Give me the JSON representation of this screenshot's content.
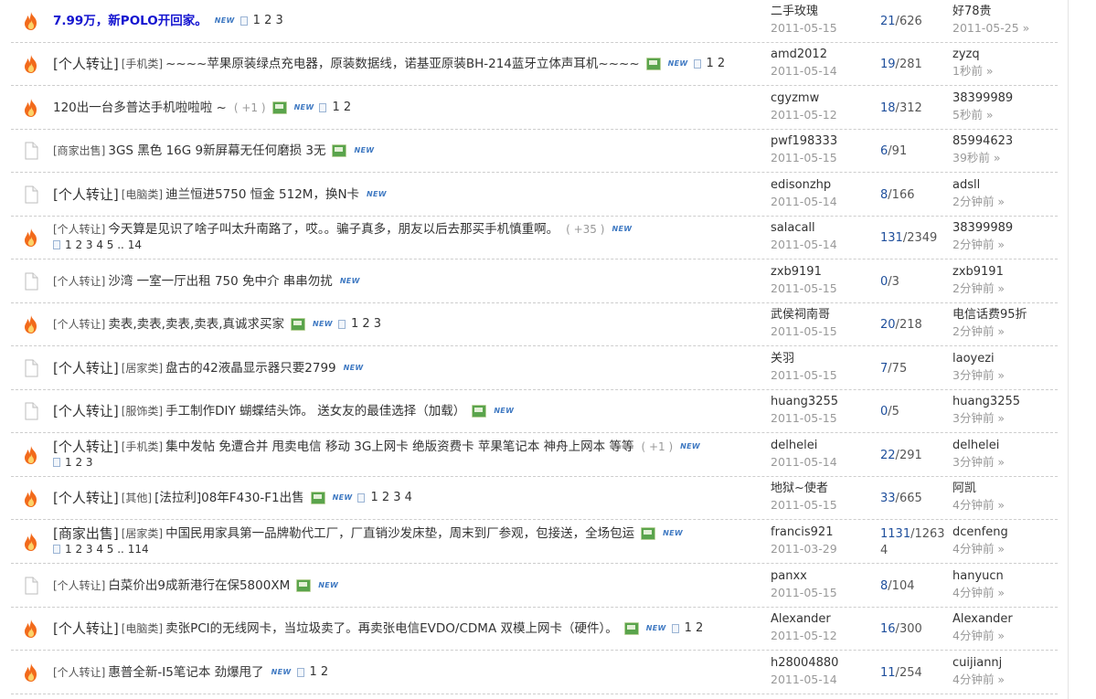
{
  "threads": [
    {
      "icon": "hot",
      "tag": "",
      "cat": "",
      "title": "7.99万，新POLO开回家。",
      "highlight": true,
      "recc": "",
      "img": false,
      "pages": "1 2 3",
      "pages_sub": "",
      "author": "二手玫瑰",
      "date": "2011-05-15",
      "replies": "21",
      "views": "626",
      "last_name": "好78贵",
      "last_time": "2011-05-25 »"
    },
    {
      "icon": "hot",
      "tag": "[个人转让]",
      "cat": "[手机类]",
      "title": "~~~~苹果原装绿点充电器，原装数据线，诺基亚原装BH-214蓝牙立体声耳机~~~~",
      "highlight": false,
      "recc": "",
      "img": true,
      "pages": "1 2",
      "pages_sub": "",
      "author": "amd2012",
      "date": "2011-05-14",
      "replies": "19",
      "views": "281",
      "last_name": "zyzq",
      "last_time": "1秒前 »"
    },
    {
      "icon": "hot",
      "tag": "",
      "cat": "",
      "title": "120出一台多普达手机啦啦啦 ~",
      "highlight": false,
      "recc": "( +1 )",
      "img": true,
      "pages": "1 2",
      "pages_sub": "",
      "author": "cgyzmw",
      "date": "2011-05-12",
      "replies": "18",
      "views": "312",
      "last_name": "38399989",
      "last_time": "5秒前 »"
    },
    {
      "icon": "file",
      "tag": "",
      "cat": "[商家出售]",
      "title": "3GS 黑色 16G 9新屏幕无任何磨损 3无",
      "highlight": false,
      "recc": "",
      "img": true,
      "pages": "",
      "pages_sub": "",
      "author": "pwf198333",
      "date": "2011-05-15",
      "replies": "6",
      "views": "91",
      "last_name": "85994623",
      "last_time": "39秒前 »"
    },
    {
      "icon": "file",
      "tag": "[个人转让]",
      "cat": "[电脑类]",
      "title": "迪兰恒进5750 恒金 512M，换N卡",
      "highlight": false,
      "recc": "",
      "img": false,
      "pages": "",
      "pages_sub": "",
      "author": "edisonzhp",
      "date": "2011-05-14",
      "replies": "8",
      "views": "166",
      "last_name": "adsll",
      "last_time": "2分钟前 »"
    },
    {
      "icon": "hot",
      "tag": "",
      "cat": "[个人转让]",
      "title": "今天算是见识了啥子叫太升南路了，哎。。骗子真多，朋友以后去那买手机慎重啊。",
      "highlight": false,
      "recc": "( +35 )",
      "img": false,
      "pages": "",
      "pages_sub": "1 2 3 4 5 .. 14",
      "author": "salacall",
      "date": "2011-05-14",
      "replies": "131",
      "views": "2349",
      "last_name": "38399989",
      "last_time": "2分钟前 »"
    },
    {
      "icon": "file",
      "tag": "",
      "cat": "[个人转让]",
      "title": "沙湾 一室一厅出租 750  免中介 串串勿扰",
      "highlight": false,
      "recc": "",
      "img": false,
      "pages": "",
      "pages_sub": "",
      "author": "zxb9191",
      "date": "2011-05-15",
      "replies": "0",
      "views": "3",
      "last_name": "zxb9191",
      "last_time": "2分钟前 »"
    },
    {
      "icon": "hot",
      "tag": "",
      "cat": "[个人转让]",
      "title": "卖表,卖表,卖表,卖表,真诚求买家",
      "highlight": false,
      "recc": "",
      "img": true,
      "pages": "1 2 3",
      "pages_sub": "",
      "author": "武侯祠南哥",
      "date": "2011-05-15",
      "replies": "20",
      "views": "218",
      "last_name": "电信话费95折",
      "last_time": "2分钟前 »"
    },
    {
      "icon": "file",
      "tag": "[个人转让]",
      "cat": "[居家类]",
      "title": "盘古的42液晶显示器只要2799",
      "highlight": false,
      "recc": "",
      "img": false,
      "pages": "",
      "pages_sub": "",
      "author": "关羽",
      "date": "2011-05-15",
      "replies": "7",
      "views": "75",
      "last_name": "laoyezi",
      "last_time": "3分钟前 »"
    },
    {
      "icon": "file",
      "tag": "[个人转让]",
      "cat": "[服饰类]",
      "title": "手工制作DIY 蝴蝶结头饰。 送女友的最佳选择（加载）",
      "highlight": false,
      "recc": "",
      "img": true,
      "pages": "",
      "pages_sub": "",
      "author": "huang3255",
      "date": "2011-05-15",
      "replies": "0",
      "views": "5",
      "last_name": "huang3255",
      "last_time": "3分钟前 »"
    },
    {
      "icon": "hot",
      "tag": "[个人转让]",
      "cat": "[手机类]",
      "title": "集中发帖 免遭合并 甩卖电信 移动 3G上网卡 绝版资费卡 苹果笔记本 神舟上网本 等等",
      "highlight": false,
      "recc": "( +1 )",
      "img": false,
      "pages": "",
      "pages_sub": "1 2 3",
      "author": "delhelei",
      "date": "2011-05-14",
      "replies": "22",
      "views": "291",
      "last_name": "delhelei",
      "last_time": "3分钟前 »"
    },
    {
      "icon": "hot",
      "tag": "[个人转让]",
      "cat": "[其他]",
      "title": "[法拉利]08年F430-F1出售",
      "highlight": false,
      "recc": "",
      "img": true,
      "pages": "1 2 3 4",
      "pages_sub": "",
      "author": "地狱~使者",
      "date": "2011-05-15",
      "replies": "33",
      "views": "665",
      "last_name": "阿凯",
      "last_time": "4分钟前 »"
    },
    {
      "icon": "hot",
      "tag": "[商家出售]",
      "cat": "[居家类]",
      "title": "中国民用家具第一品牌勒代工厂，厂直销沙发床垫，周末到厂参观，包接送，全场包运",
      "highlight": false,
      "recc": "",
      "img": true,
      "pages": "",
      "pages_sub": "1 2 3 4 5 .. 114",
      "author": "francis921",
      "date": "2011-03-29",
      "replies": "1131",
      "views": "12634",
      "last_name": "dcenfeng",
      "last_time": "4分钟前 »"
    },
    {
      "icon": "file",
      "tag": "",
      "cat": "[个人转让]",
      "title": "白菜价出9成新港行在保5800XM",
      "highlight": false,
      "recc": "",
      "img": true,
      "pages": "",
      "pages_sub": "",
      "author": "panxx",
      "date": "2011-05-15",
      "replies": "8",
      "views": "104",
      "last_name": "hanyucn",
      "last_time": "4分钟前 »"
    },
    {
      "icon": "hot",
      "tag": "[个人转让]",
      "cat": "[电脑类]",
      "title": "卖张PCI的无线网卡，当垃圾卖了。再卖张电信EVDO/CDMA 双模上网卡（硬件）。",
      "highlight": false,
      "recc": "",
      "img": true,
      "pages": "1 2",
      "pages_sub": "",
      "author": "Alexander",
      "date": "2011-05-12",
      "replies": "16",
      "views": "300",
      "last_name": "Alexander",
      "last_time": "4分钟前 »"
    },
    {
      "icon": "hot",
      "tag": "",
      "cat": "[个人转让]",
      "title": "惠普全新-I5笔记本 劲爆甩了",
      "highlight": false,
      "recc": "",
      "img": false,
      "pages": "1 2",
      "pages_sub": "",
      "author": "h28004880",
      "date": "2011-05-14",
      "replies": "11",
      "views": "254",
      "last_name": "cuijiannj",
      "last_time": "4分钟前 »"
    }
  ],
  "new_label": "NEW",
  "colors": {
    "hot_flame": "#f26a1b",
    "link": "#1515d0",
    "reply_count": "#1f4f9c"
  }
}
